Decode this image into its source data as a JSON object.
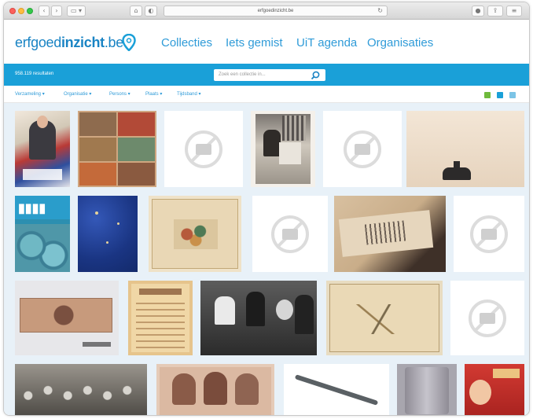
{
  "browser": {
    "address": "erfgoedinzicht.be"
  },
  "header": {
    "logo_plain": "erfgoed",
    "logo_bold": "inzicht",
    "logo_tld": ".be",
    "nav": [
      "Collecties",
      "Iets gemist",
      "UiT agenda",
      "Organisaties"
    ]
  },
  "toolbar": {
    "results": "958.119 resultaten",
    "search_placeholder": "Zoek een collectie in..."
  },
  "filters": [
    "Verzameling",
    "Organisatie",
    "Persons",
    "Plaats",
    "Tijdsband"
  ],
  "colors": {
    "brand_blue": "#1aa0d8",
    "link_blue": "#2f9bd8",
    "grid_bg": "#e8f1f8"
  },
  "grid": {
    "tiles": [
      {
        "kind": "image",
        "subject": "cyclist-poster"
      },
      {
        "kind": "image",
        "subject": "comic-panels"
      },
      {
        "kind": "placeholder"
      },
      {
        "kind": "image",
        "subject": "photo-child-chair"
      },
      {
        "kind": "placeholder"
      },
      {
        "kind": "image",
        "subject": "beige-photo-object"
      },
      {
        "kind": "image",
        "subject": "clio-cover"
      },
      {
        "kind": "image",
        "subject": "blue-fabric"
      },
      {
        "kind": "image",
        "subject": "illustrated-sheet"
      },
      {
        "kind": "placeholder"
      },
      {
        "kind": "image",
        "subject": "figure-drawing"
      },
      {
        "kind": "placeholder"
      },
      {
        "kind": "image",
        "subject": "textile-heart"
      },
      {
        "kind": "image",
        "subject": "printed-page"
      },
      {
        "kind": "image",
        "subject": "group-photo-bw"
      },
      {
        "kind": "image",
        "subject": "old-map"
      },
      {
        "kind": "placeholder"
      },
      {
        "kind": "image",
        "subject": "class-photo"
      },
      {
        "kind": "image",
        "subject": "portrait-women"
      },
      {
        "kind": "image",
        "subject": "metal-tool"
      },
      {
        "kind": "image",
        "subject": "glass-object"
      },
      {
        "kind": "image",
        "subject": "red-poster"
      }
    ]
  }
}
